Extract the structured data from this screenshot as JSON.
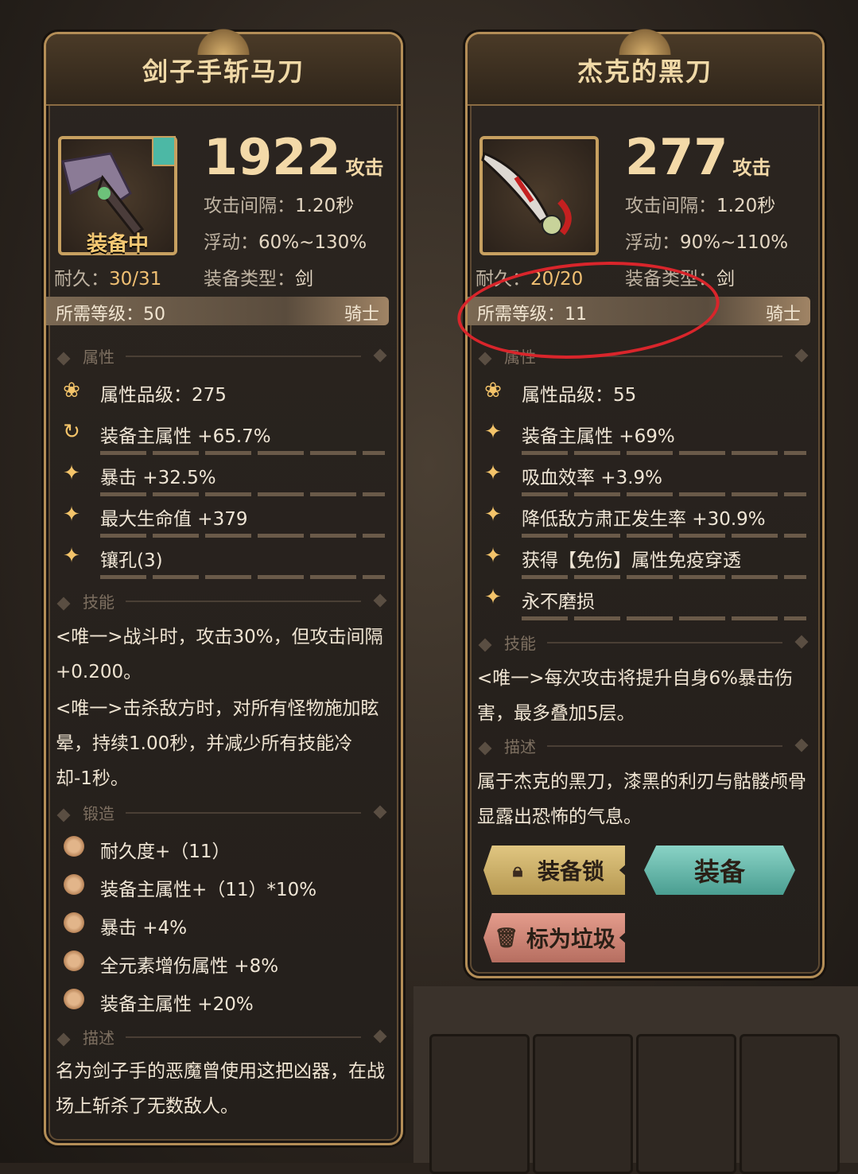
{
  "left": {
    "name": "剑子手斩马刀",
    "equipped_label": "装备中",
    "attack": "1922",
    "attack_suffix": "攻击",
    "interval_label": "攻击间隔：",
    "interval_value": "1.20秒",
    "float_label": "浮动：",
    "float_value": "60%~130%",
    "type_label": "装备类型：",
    "type_value": "剑",
    "durability_label": "耐久：",
    "durability_value": "30/31",
    "req_label": "所需等级：50",
    "class": "骑士",
    "section_attr": "属性",
    "props": [
      {
        "icon": "lotus-icon",
        "glyph": "❀",
        "text": "属性品级：275"
      },
      {
        "icon": "refresh-icon",
        "glyph": "↻",
        "text": "装备主属性 +65.7%"
      },
      {
        "icon": "sparkle-icon",
        "glyph": "✦",
        "text": "暴击 +32.5%"
      },
      {
        "icon": "sparkle-icon",
        "glyph": "✦",
        "text": "最大生命值 +379"
      },
      {
        "icon": "sparkle-icon",
        "glyph": "✦",
        "text": "镶孔(3)"
      }
    ],
    "section_skill": "技能",
    "skills": [
      "<唯一>战斗时，攻击30%，但攻击间隔+0.200。",
      "<唯一>击杀敌方时，对所有怪物施加眩晕，持续1.00秒，并减少所有技能冷却-1秒。"
    ],
    "section_forge": "锻造",
    "forge": [
      "耐久度+（11）",
      "装备主属性+（11）*10%",
      "暴击 +4%",
      "全元素增伤属性 +8%",
      "装备主属性 +20%"
    ],
    "section_desc": "描述",
    "description": "名为剑子手的恶魔曾使用这把凶器，在战场上斩杀了无数敌人。"
  },
  "right": {
    "name": "杰克的黑刀",
    "attack": "277",
    "attack_suffix": "攻击",
    "interval_label": "攻击间隔：",
    "interval_value": "1.20秒",
    "float_label": "浮动：",
    "float_value": "90%~110%",
    "type_label": "装备类型：",
    "type_value": "剑",
    "durability_label": "耐久：",
    "durability_value": "20/20",
    "req_label": "所需等级：11",
    "class": "骑士",
    "section_attr": "属性",
    "props": [
      {
        "icon": "lotus-icon",
        "glyph": "❀",
        "text": "属性品级：55"
      },
      {
        "icon": "sparkle-icon",
        "glyph": "✦",
        "text": "装备主属性 +69%"
      },
      {
        "icon": "sparkle-icon",
        "glyph": "✦",
        "text": "吸血效率 +3.9%"
      },
      {
        "icon": "sparkle-icon",
        "glyph": "✦",
        "text": "降低敌方肃正发生率 +30.9%"
      },
      {
        "icon": "sparkle-icon",
        "glyph": "✦",
        "text": "获得【免伤】属性免疫穿透"
      },
      {
        "icon": "sparkle-icon",
        "glyph": "✦",
        "text": "永不磨损"
      }
    ],
    "section_skill": "技能",
    "skill": "<唯一>每次攻击将提升自身6%暴击伤害，最多叠加5层。",
    "section_desc": "描述",
    "description": "属于杰克的黑刀，漆黑的利刃与骷髅颅骨显露出恐怖的气息。",
    "btn_lock": "装备锁",
    "btn_equip": "装备",
    "btn_trash": "标为垃圾"
  },
  "colors": {
    "accent_gold": "#c7a060",
    "equip_teal": "#4a9e91",
    "annotation_red": "#d9252b"
  }
}
